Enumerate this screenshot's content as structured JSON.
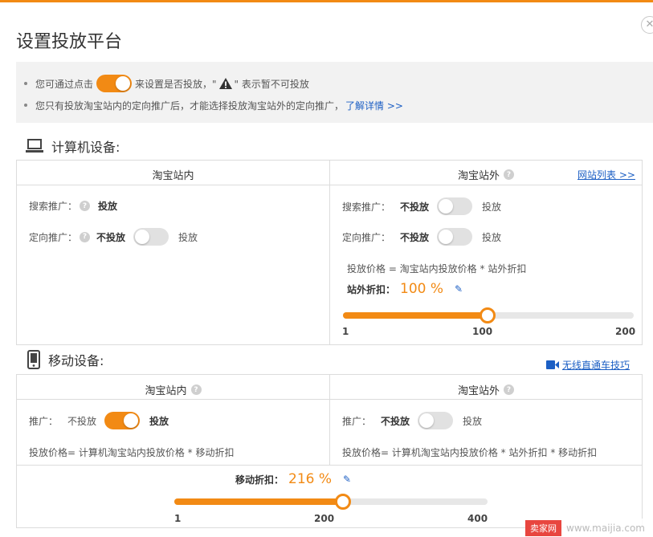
{
  "dialog": {
    "title": "设置投放平台",
    "close_glyph": "✕"
  },
  "notice": {
    "line1_before": "您可通过点击",
    "line1_after": "来设置是否投放，\"",
    "line1_tail": "\" 表示暂不可投放",
    "line2_text": "您只有投放淘宝站内的定向推广后，才能选择投放淘宝站外的定向推广，",
    "line2_link": "了解详情 >>"
  },
  "pc": {
    "heading": "计算机设备:",
    "inside": {
      "title": "淘宝站内",
      "search_label": "搜索推广：",
      "search_value": "投放",
      "target_label": "定向推广：",
      "target_off": "不投放",
      "target_on": "投放"
    },
    "outside": {
      "title": "淘宝站外",
      "site_list_link": "网站列表 >>",
      "search_label": "搜索推广：",
      "search_off": "不投放",
      "search_on": "投放",
      "target_label": "定向推广：",
      "target_off": "不投放",
      "target_on": "投放",
      "price_formula": "投放价格 = 淘宝站内投放价格 * 站外折扣",
      "discount_label": "站外折扣：",
      "discount_value": "100 %",
      "slider": {
        "min": "1",
        "mid": "100",
        "max": "200",
        "value": 100
      }
    }
  },
  "mobile": {
    "heading": "移动设备:",
    "tips_link": "无线直通车技巧",
    "inside": {
      "title": "淘宝站内",
      "promo_label": "推广：",
      "promo_off": "不投放",
      "promo_on": "投放",
      "price_formula": "投放价格= 计算机淘宝站内投放价格 * 移动折扣"
    },
    "outside": {
      "title": "淘宝站外",
      "promo_label": "推广：",
      "promo_off": "不投放",
      "promo_on": "投放",
      "price_formula": "投放价格= 计算机淘宝站内投放价格 * 站外折扣 * 移动折扣"
    },
    "discount_label": "移动折扣：",
    "discount_value": "216 %",
    "slider": {
      "min": "1",
      "mid": "200",
      "max": "400",
      "value": 216
    }
  },
  "watermark": {
    "logo": "卖家网",
    "url": "www.maijia.com"
  },
  "colors": {
    "accent": "#f28a14",
    "link": "#1c5fc4"
  }
}
